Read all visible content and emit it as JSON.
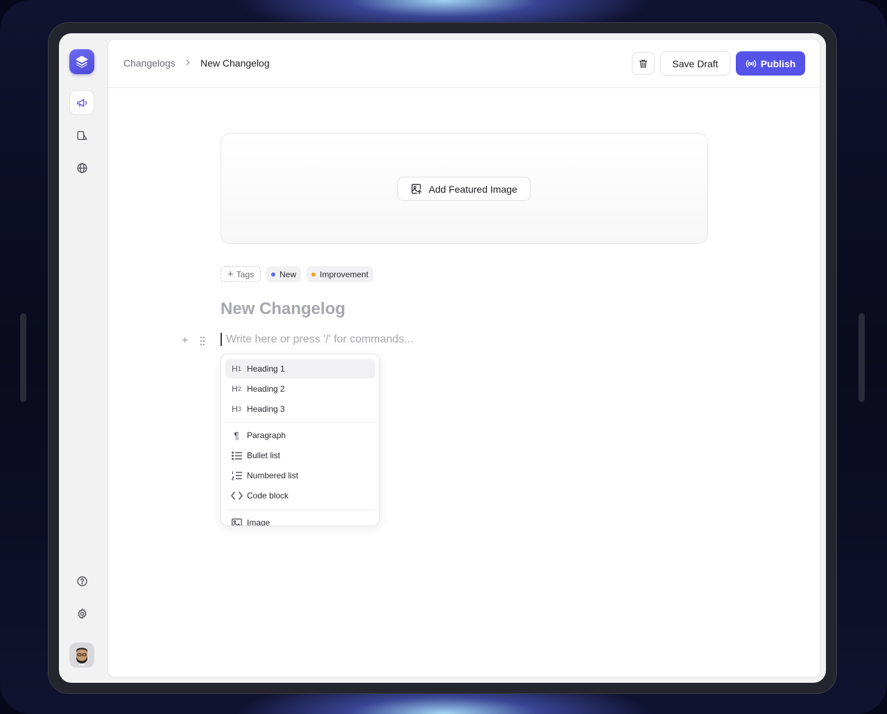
{
  "breadcrumb": {
    "parent": "Changelogs",
    "current": "New Changelog"
  },
  "toolbar": {
    "save_draft": "Save Draft",
    "publish": "Publish"
  },
  "featured_image": {
    "label": "Add Featured Image"
  },
  "tags": {
    "add_label": "Tags",
    "items": [
      {
        "label": "New",
        "color": "#5b6cf0"
      },
      {
        "label": "Improvement",
        "color": "#e9a81c"
      }
    ]
  },
  "editor": {
    "title_placeholder": "New Changelog",
    "body_placeholder": "Write here or press '/' for commands..."
  },
  "command_menu": {
    "items": [
      {
        "label": "Heading 1",
        "icon": "heading-1-icon"
      },
      {
        "label": "Heading 2",
        "icon": "heading-2-icon"
      },
      {
        "label": "Heading 3",
        "icon": "heading-3-icon"
      },
      {
        "label": "Paragraph",
        "icon": "paragraph-icon"
      },
      {
        "label": "Bullet list",
        "icon": "bullet-list-icon"
      },
      {
        "label": "Numbered list",
        "icon": "numbered-list-icon"
      },
      {
        "label": "Code block",
        "icon": "code-icon"
      },
      {
        "label": "Image",
        "icon": "image-icon"
      }
    ]
  },
  "colors": {
    "accent": "#5653e8",
    "new_tag": "#5b6cf0",
    "improvement_tag": "#e9a81c"
  }
}
